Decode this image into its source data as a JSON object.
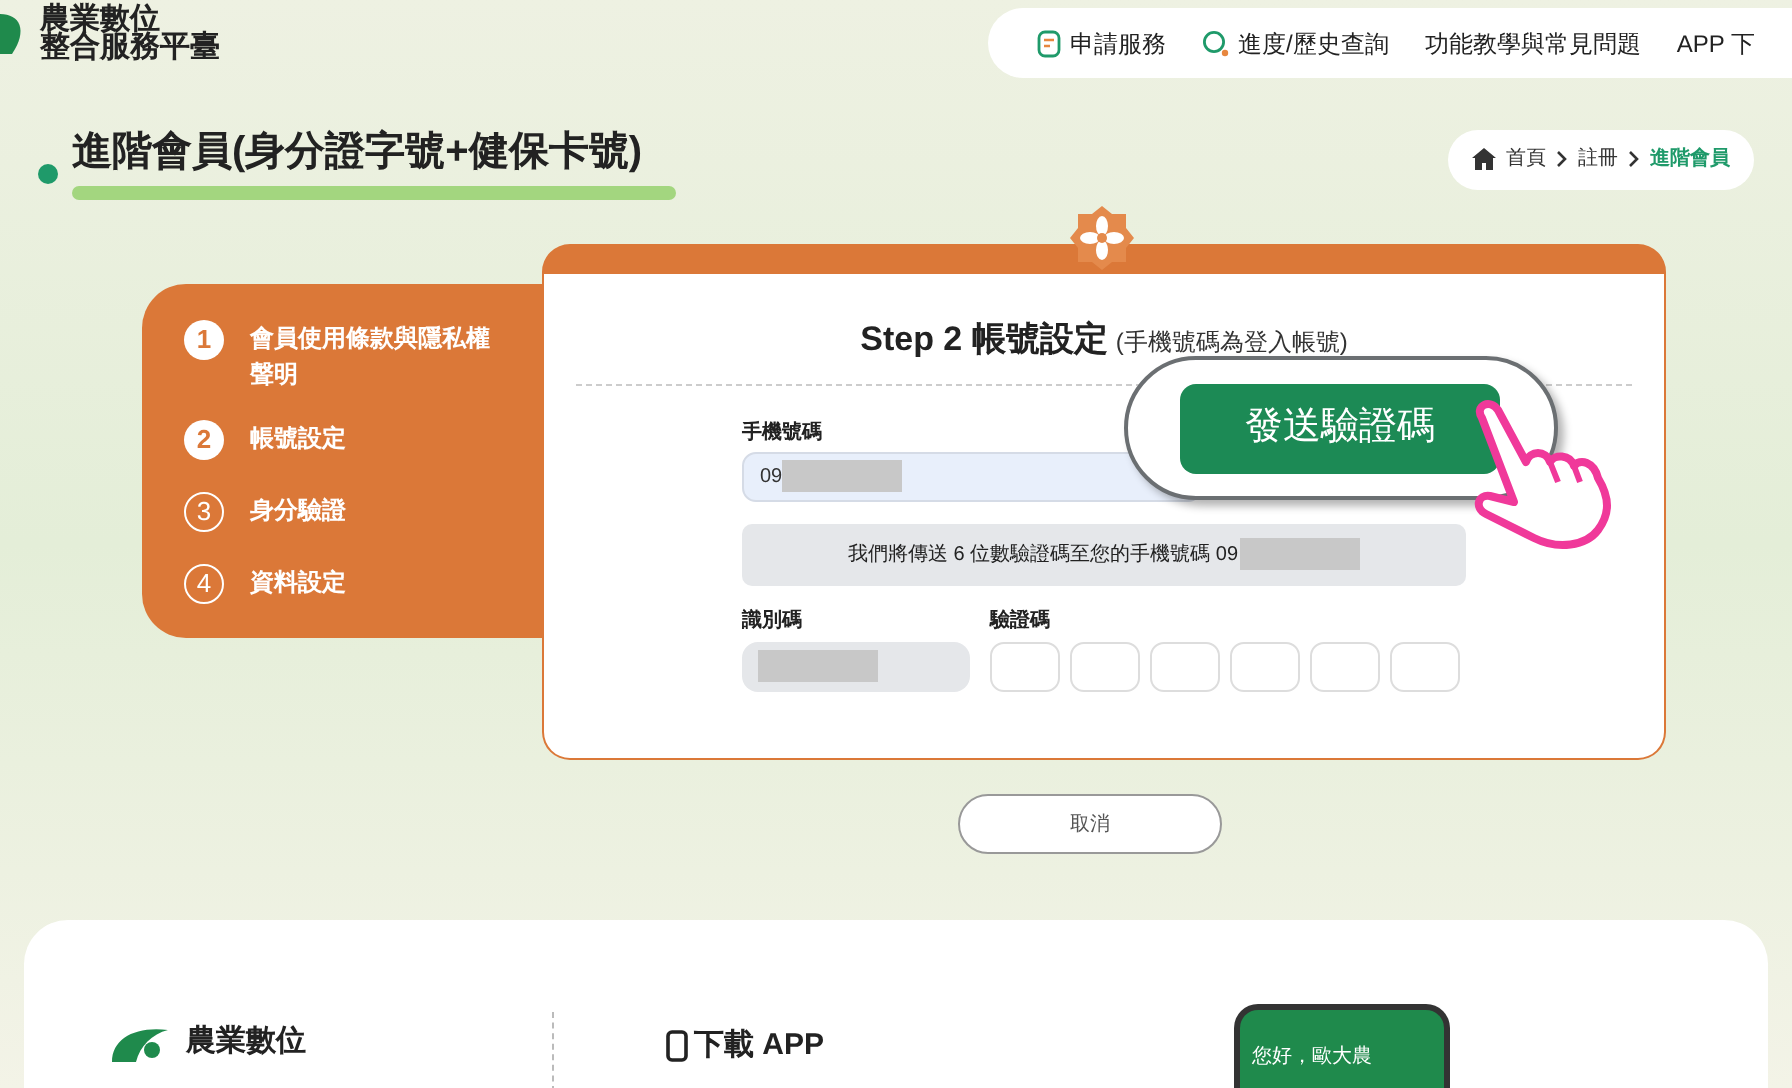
{
  "header": {
    "logo_lines": [
      "農業數位",
      "整合服務平臺"
    ],
    "nav": [
      {
        "label": "申請服務"
      },
      {
        "label": "進度/歷史查詢"
      },
      {
        "label": "功能教學與常見問題"
      },
      {
        "label": "APP 下"
      }
    ]
  },
  "page_title": "進階會員(身分證字號+健保卡號)",
  "breadcrumb": [
    {
      "label": "首頁",
      "current": false
    },
    {
      "label": "註冊",
      "current": false
    },
    {
      "label": "進階會員",
      "current": true
    }
  ],
  "steps": [
    {
      "number": "1",
      "label": "會員使用條款與隱私權聲明",
      "active": true
    },
    {
      "number": "2",
      "label": "帳號設定",
      "active": true
    },
    {
      "number": "3",
      "label": "身分驗證",
      "active": false
    },
    {
      "number": "4",
      "label": "資料設定",
      "active": false
    }
  ],
  "form": {
    "title": "Step 2 帳號設定",
    "subtitle": "(手機號碼為登入帳號)",
    "phone_label": "手機號碼",
    "phone_value": "09",
    "send_button": "發送驗證碼",
    "notice": "我們將傳送 6 位數驗證碼至您的手機號碼 09",
    "id_label": "識別碼",
    "code_label": "驗證碼"
  },
  "cancel_button": "取消",
  "footer": {
    "logo_text": "農業數位",
    "download_title": "下載 APP",
    "phone_greeting": "您好，歐大農"
  }
}
